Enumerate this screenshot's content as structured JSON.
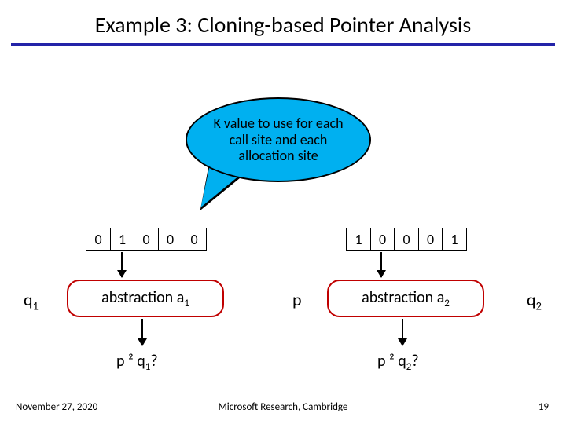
{
  "title": "Example 3: Cloning-based Pointer Analysis",
  "bubble": "K value to use for each call site and each allocation site",
  "left_cells": [
    "0",
    "1",
    "0",
    "0",
    "0"
  ],
  "right_cells": [
    "1",
    "0",
    "0",
    "0",
    "1"
  ],
  "q1": "q",
  "q1sub": "1",
  "q2": "q",
  "q2sub": "2",
  "p": "p",
  "abs1_pre": "abstraction a",
  "abs1_sub": "1",
  "abs2_pre": "abstraction a",
  "abs2_sub": "2",
  "query1_a": "p ",
  "query1_op": "²",
  "query1_b": " q",
  "query1_sub": "1",
  "query1_q": "?",
  "query2_a": "p ",
  "query2_op": "²",
  "query2_b": " q",
  "query2_sub": "2",
  "query2_q": "?",
  "footer_date": "November 27, 2020",
  "footer_org": "Microsoft Research, Cambridge",
  "footer_page": "19"
}
